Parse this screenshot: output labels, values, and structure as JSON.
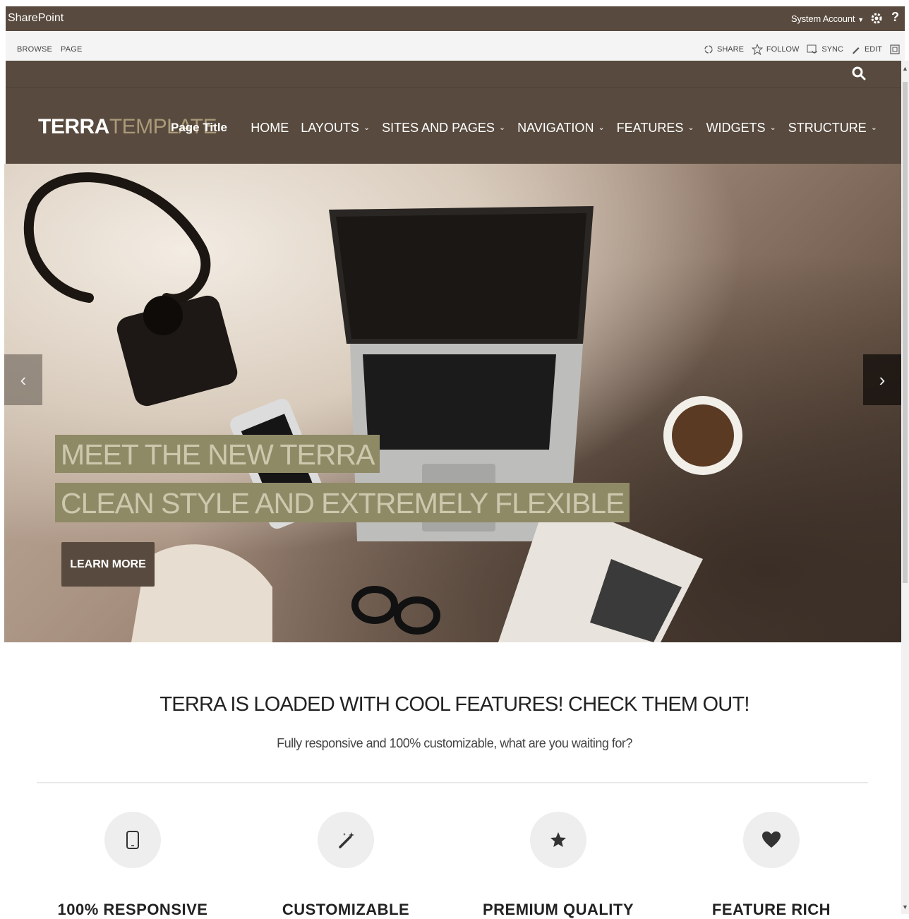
{
  "suitebar": {
    "brand": "SharePoint",
    "account": "System Account",
    "help": "?"
  },
  "ribbon": {
    "tabs": [
      "BROWSE",
      "PAGE"
    ],
    "actions": [
      "SHARE",
      "FOLLOW",
      "SYNC",
      "EDIT"
    ]
  },
  "site": {
    "logo_bold": "TERRA",
    "logo_light": "TEMPLATE",
    "page_title": "Page Title",
    "nav": [
      "HOME",
      "LAYOUTS",
      "SITES AND PAGES",
      "NAVIGATION",
      "FEATURES",
      "WIDGETS",
      "STRUCTURE"
    ]
  },
  "hero": {
    "caption_line1": "MEET THE NEW TERRA",
    "caption_line2": "CLEAN STYLE AND EXTREMELY FLEXIBLE",
    "button": "LEARN MORE",
    "prev": "‹",
    "next": "›"
  },
  "features": {
    "title": "TERRA IS LOADED WITH COOL FEATURES! CHECK THEM OUT!",
    "subtitle": "Fully responsive and 100% customizable, what are you waiting for?",
    "items": [
      {
        "icon": "tablet-icon",
        "label": "100% RESPONSIVE"
      },
      {
        "icon": "magic-wand-icon",
        "label": "CUSTOMIZABLE"
      },
      {
        "icon": "star-icon",
        "label": "PREMIUM QUALITY"
      },
      {
        "icon": "heart-icon",
        "label": "FEATURE RICH"
      }
    ]
  },
  "colors": {
    "brand_brown": "#584a3e",
    "accent_olive": "#8f8a66",
    "logo_tan": "#a99a79"
  }
}
